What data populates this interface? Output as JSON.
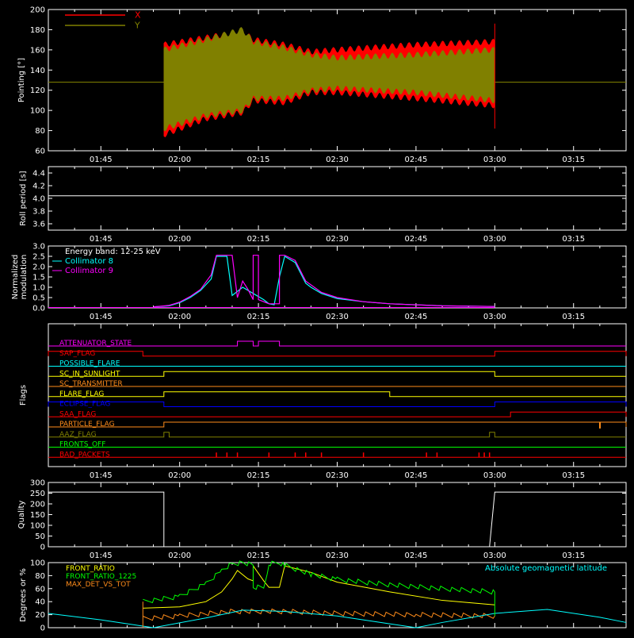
{
  "colors": {
    "background": "#000000",
    "axes": "#ffffff",
    "x_series": "#ff0000",
    "y_series": "#808000",
    "white": "#ffffff",
    "cyan": "#00ffff",
    "magenta": "#ff00ff",
    "red": "#ff0000",
    "orange": "#ff8c1a",
    "yellow": "#ffff00",
    "blue": "#0000ff",
    "green": "#00ff00",
    "olive": "#808000"
  },
  "chart_data": [
    {
      "id": "pointing",
      "type": "line",
      "title": "",
      "xlabel": "",
      "ylabel": "Pointing [°]",
      "xlim": [
        "01:35",
        "03:25"
      ],
      "ylim": [
        60,
        200
      ],
      "x_tick_labels": [
        "01:45",
        "02:00",
        "02:15",
        "02:30",
        "02:45",
        "03:00",
        "03:15"
      ],
      "y_tick_labels": [
        "60",
        "80",
        "100",
        "120",
        "140",
        "160",
        "180",
        "200"
      ],
      "legend_position": "top-left",
      "series": [
        {
          "name": "X",
          "color": "#ff0000",
          "baseline": 128,
          "active_range": [
            "01:57",
            "03:00"
          ],
          "envelope": [
            {
              "t": "01:57",
              "low": 76,
              "high": 165
            },
            {
              "t": "02:05",
              "low": 92,
              "high": 172
            },
            {
              "t": "02:12",
              "low": 98,
              "high": 178
            },
            {
              "t": "02:14",
              "low": 110,
              "high": 170
            },
            {
              "t": "02:20",
              "low": 108,
              "high": 165
            },
            {
              "t": "02:25",
              "low": 118,
              "high": 158
            },
            {
              "t": "02:30",
              "low": 118,
              "high": 160
            },
            {
              "t": "02:45",
              "low": 112,
              "high": 165
            },
            {
              "t": "03:00",
              "low": 105,
              "high": 168
            }
          ]
        },
        {
          "name": "Y",
          "color": "#808000",
          "baseline": 128,
          "active_range": [
            "01:57",
            "03:00"
          ],
          "envelope": [
            {
              "t": "01:57",
              "low": 82,
              "high": 160
            },
            {
              "t": "02:05",
              "low": 95,
              "high": 170
            },
            {
              "t": "02:12",
              "low": 100,
              "high": 180
            },
            {
              "t": "02:14",
              "low": 112,
              "high": 168
            },
            {
              "t": "02:20",
              "low": 112,
              "high": 162
            },
            {
              "t": "02:25",
              "low": 120,
              "high": 155
            },
            {
              "t": "02:30",
              "low": 122,
              "high": 152
            },
            {
              "t": "02:45",
              "low": 118,
              "high": 155
            },
            {
              "t": "03:00",
              "low": 110,
              "high": 160
            }
          ]
        }
      ]
    },
    {
      "id": "roll",
      "type": "line",
      "title": "",
      "xlabel": "",
      "ylabel": "Roll period [s]",
      "xlim": [
        "01:35",
        "03:25"
      ],
      "ylim": [
        3.5,
        4.5
      ],
      "x_tick_labels": [
        "01:45",
        "02:00",
        "02:15",
        "02:30",
        "02:45",
        "03:00",
        "03:15"
      ],
      "y_tick_labels": [
        "3.6",
        "3.8",
        "4.0",
        "4.2",
        "4.4"
      ],
      "series": [
        {
          "name": "",
          "color": "#ffffff",
          "x": [
            "01:35",
            "03:25"
          ],
          "y": [
            4.04,
            4.04
          ]
        }
      ]
    },
    {
      "id": "modulation",
      "type": "line",
      "title": "",
      "xlabel": "",
      "ylabel": "Normalized modulation",
      "xlim": [
        "01:35",
        "03:25"
      ],
      "ylim": [
        0.0,
        3.0
      ],
      "x_tick_labels": [
        "01:45",
        "02:00",
        "02:15",
        "02:30",
        "02:45",
        "03:00",
        "03:15"
      ],
      "y_tick_labels": [
        "0.0",
        "0.5",
        "1.0",
        "1.5",
        "2.0",
        "2.5",
        "3.0"
      ],
      "legend_position": "top-left",
      "legend_header": "Energy band: 12-25 keV",
      "series": [
        {
          "name": "Collimator 8",
          "color": "#00ffff",
          "x": [
            "01:55",
            "01:58",
            "02:00",
            "02:02",
            "02:04",
            "02:06",
            "02:07",
            "02:09",
            "02:10",
            "02:12",
            "02:14",
            "02:16",
            "02:17",
            "02:18",
            "02:19",
            "02:20",
            "02:22",
            "02:24",
            "02:25",
            "02:27",
            "02:30",
            "02:35",
            "02:40",
            "02:45",
            "02:50",
            "03:00"
          ],
          "y": [
            0.05,
            0.1,
            0.25,
            0.5,
            0.85,
            1.4,
            2.5,
            2.5,
            0.6,
            1.0,
            0.7,
            0.4,
            0.2,
            0.15,
            1.5,
            2.5,
            2.2,
            1.2,
            1.0,
            0.7,
            0.45,
            0.3,
            0.2,
            0.15,
            0.1,
            0.07
          ]
        },
        {
          "name": "Collimator 9",
          "color": "#ff00ff",
          "x": [
            "01:55",
            "01:58",
            "02:00",
            "02:02",
            "02:04",
            "02:06",
            "02:07",
            "02:09",
            "02:10",
            "02:11",
            "02:12",
            "02:13",
            "02:14",
            "02:14",
            "02:15",
            "02:15",
            "02:16",
            "02:17",
            "02:18",
            "02:19",
            "02:19",
            "02:20",
            "02:22",
            "02:24",
            "02:27",
            "02:30",
            "02:35",
            "02:40",
            "02:45",
            "02:50",
            "03:00"
          ],
          "y": [
            0.05,
            0.12,
            0.28,
            0.55,
            0.9,
            1.6,
            2.55,
            2.55,
            2.55,
            0.5,
            1.3,
            0.9,
            0.4,
            2.55,
            2.55,
            0.4,
            0.3,
            0.2,
            0.2,
            0.2,
            2.55,
            2.55,
            2.3,
            1.3,
            0.75,
            0.5,
            0.3,
            0.2,
            0.15,
            0.1,
            0.07
          ]
        }
      ]
    },
    {
      "id": "flags",
      "type": "line",
      "title": "",
      "xlabel": "",
      "ylabel": "Flags",
      "xlim": [
        "01:35",
        "03:25"
      ],
      "x_tick_labels": [
        "01:45",
        "02:00",
        "02:15",
        "02:30",
        "02:45",
        "03:00",
        "03:15"
      ],
      "flags": [
        {
          "name": "ATTENUATOR_STATE",
          "color": "#ff00ff",
          "segments": [
            {
              "from": "02:11",
              "to": "02:14",
              "state": 1
            },
            {
              "from": "02:15",
              "to": "02:19",
              "state": 1
            }
          ]
        },
        {
          "name": "SAP_FLAG",
          "color": "#ff0000",
          "segments": [
            {
              "from": "01:35",
              "to": "01:53",
              "state": 1
            },
            {
              "from": "03:00",
              "to": "03:25",
              "state": 1
            }
          ]
        },
        {
          "name": "POSSIBLE_FLARE",
          "color": "#00ffff",
          "segments": []
        },
        {
          "name": "SC_IN_SUNLIGHT",
          "color": "#ffff00",
          "segments": [
            {
              "from": "01:57",
              "to": "03:00",
              "state": 1
            }
          ]
        },
        {
          "name": "SC_TRANSMITTER",
          "color": "#ff8c1a",
          "segments": []
        },
        {
          "name": "FLARE_FLAG",
          "color": "#ffff00",
          "segments": [
            {
              "from": "01:57",
              "to": "02:40",
              "state": 1
            }
          ]
        },
        {
          "name": "ECLIPSE_FLAG",
          "color": "#0000ff",
          "segments": [
            {
              "from": "01:35",
              "to": "01:57",
              "state": 1
            },
            {
              "from": "03:00",
              "to": "03:25",
              "state": 1
            }
          ]
        },
        {
          "name": "SAA_FLAG",
          "color": "#ff0000",
          "segments": [
            {
              "from": "03:03",
              "to": "03:25",
              "state": 1
            }
          ]
        },
        {
          "name": "PARTICLE_FLAG",
          "color": "#ff8c1a",
          "segments": [
            {
              "from": "01:57",
              "to": "03:25",
              "state": 1
            }
          ]
        },
        {
          "name": "AAZ_FLAG",
          "color": "#808000",
          "segments": [
            {
              "from": "01:57",
              "to": "01:58",
              "state": 1
            },
            {
              "from": "02:59",
              "to": "03:00",
              "state": 1
            }
          ]
        },
        {
          "name": "FRONTS_OFF",
          "color": "#00ff00",
          "segments": []
        },
        {
          "name": "BAD_PACKETS",
          "color": "#ff0000",
          "spikes": [
            "02:07",
            "02:09",
            "02:11",
            "02:17",
            "02:22",
            "02:24",
            "02:27",
            "02:35",
            "02:47",
            "02:49",
            "02:57",
            "02:58",
            "02:59"
          ]
        }
      ]
    },
    {
      "id": "quality",
      "type": "line",
      "title": "",
      "xlabel": "",
      "ylabel": "Quality",
      "xlim": [
        "01:35",
        "03:25"
      ],
      "ylim": [
        0,
        300
      ],
      "x_tick_labels": [
        "01:45",
        "02:00",
        "02:15",
        "02:30",
        "02:45",
        "03:00",
        "03:15"
      ],
      "y_tick_labels": [
        "0",
        "50",
        "100",
        "150",
        "200",
        "250",
        "300"
      ],
      "series": [
        {
          "name": "",
          "color": "#ffffff",
          "x": [
            "01:35",
            "01:57",
            "01:57",
            "02:59",
            "03:00",
            "03:25"
          ],
          "y": [
            255,
            255,
            0,
            0,
            255,
            255
          ]
        }
      ]
    },
    {
      "id": "ratios",
      "type": "line",
      "title": "",
      "xlabel": "",
      "ylabel": "Degrees or %",
      "xlim": [
        "01:35",
        "03:25"
      ],
      "ylim": [
        0,
        100
      ],
      "x_tick_labels": [],
      "y_tick_labels": [
        "0",
        "20",
        "40",
        "60",
        "80",
        "100"
      ],
      "legend_position": "top-left",
      "annotation": "Absolute geomagnetic latitude",
      "series": [
        {
          "name": "FRONT_RATIO",
          "color": "#ffff00",
          "x": [
            "01:53",
            "02:00",
            "02:05",
            "02:08",
            "02:10",
            "02:11",
            "02:13",
            "02:14",
            "02:14",
            "02:16",
            "02:17",
            "02:19",
            "02:20",
            "02:25",
            "02:30",
            "02:40",
            "02:50",
            "03:00"
          ],
          "y": [
            30,
            32,
            40,
            55,
            75,
            88,
            75,
            72,
            95,
            72,
            62,
            62,
            95,
            85,
            70,
            55,
            42,
            35
          ]
        },
        {
          "name": "FRONT_RATIO_1225",
          "color": "#00ff00",
          "x": [
            "01:53",
            "02:00",
            "02:05",
            "02:08",
            "02:10",
            "02:12",
            "02:14",
            "02:14",
            "02:16",
            "02:17",
            "02:19",
            "02:20",
            "02:25",
            "02:30",
            "02:40",
            "02:50",
            "03:00"
          ],
          "y": [
            40,
            48,
            68,
            88,
            98,
            100,
            96,
            62,
            62,
            98,
            100,
            96,
            82,
            74,
            66,
            60,
            55
          ]
        },
        {
          "name": "MAX_DET_VS_TOT",
          "color": "#ff8c1a",
          "x": [
            "01:53",
            "02:00",
            "02:10",
            "02:20",
            "02:30",
            "02:45",
            "03:00"
          ],
          "y": [
            14,
            18,
            25,
            25,
            22,
            20,
            18
          ]
        },
        {
          "name": "",
          "color": "#00ffff",
          "x": [
            "01:35",
            "01:45",
            "01:55",
            "02:05",
            "02:12",
            "02:20",
            "02:30",
            "02:40",
            "02:45",
            "02:50",
            "03:00",
            "03:10",
            "03:20",
            "03:25"
          ],
          "y": [
            22,
            12,
            0,
            15,
            27,
            25,
            18,
            6,
            0,
            8,
            22,
            28,
            16,
            8
          ]
        }
      ]
    }
  ]
}
